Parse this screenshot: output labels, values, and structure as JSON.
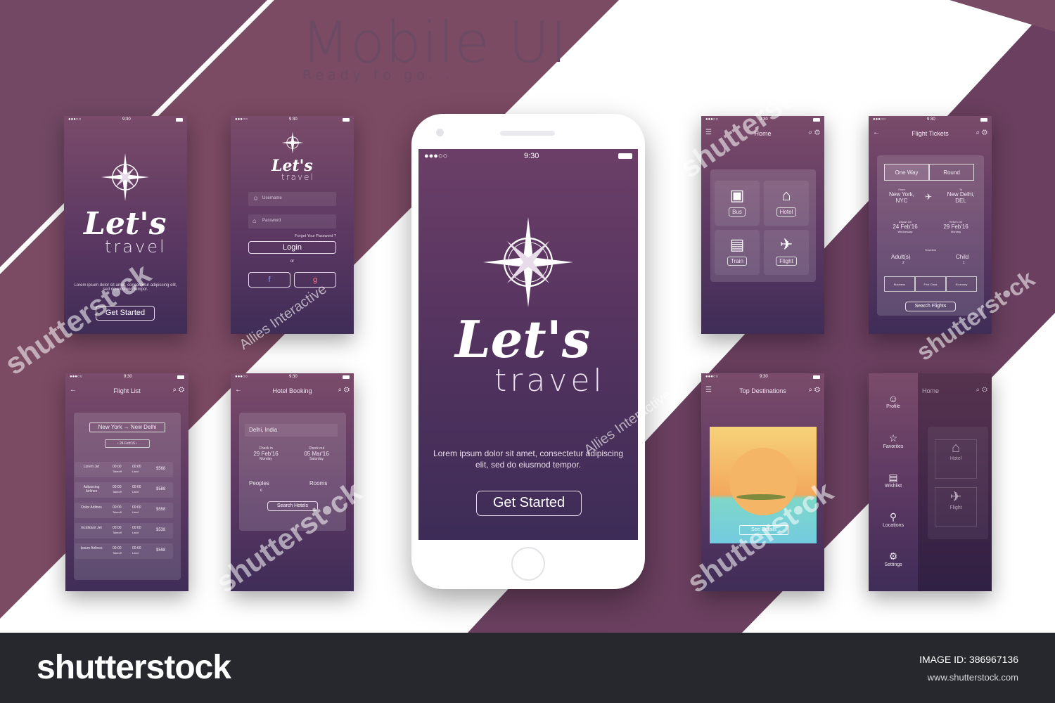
{
  "header": {
    "title": "Mobile UI",
    "subtitle": "Ready to go..."
  },
  "status": {
    "time": "9:30",
    "signal": "●●●○○"
  },
  "splash": {
    "lets": "Let's",
    "travel": "travel",
    "body": "Lorem ipsum dolor sit amet, consectetur adipiscing elit, sed do eiusmod tempor.",
    "cta": "Get Started"
  },
  "login": {
    "username_placeholder": "Username",
    "password_placeholder": "Password",
    "forgot": "Forget Your Password ?",
    "login": "Login",
    "or": "or",
    "facebook": "f",
    "google": "g"
  },
  "home": {
    "title": "Home",
    "tiles": [
      "Bus",
      "Hotel",
      "Train",
      "Flight"
    ]
  },
  "flight_tickets": {
    "title": "Flight Tickets",
    "one_way": "One Way",
    "round": "Round",
    "from_label": "From",
    "from": "New York, NYC",
    "to_label": "To",
    "to": "New Delhi, DEL",
    "depart_label": "Depart On",
    "depart": "24 Feb'16",
    "depart_day": "Wednesday",
    "return_label": "Return On",
    "return": "29 Feb'16",
    "return_day": "Monday",
    "travelers": "Travelers",
    "adults": "Adult(s)",
    "adults_count": "2",
    "child": "Child",
    "child_count": "1",
    "classes": [
      "Business",
      "First Class",
      "Economy"
    ],
    "search": "Search Flights"
  },
  "flight_list": {
    "title": "Flight List",
    "route_from": "New York",
    "route_to": "New Delhi",
    "date": "24 Feb'16",
    "rows": [
      {
        "name": "Lorem Jet",
        "takeoff": "00:00",
        "land": "00:00",
        "price": "$568"
      },
      {
        "name": "Adipiscing Airlines",
        "takeoff": "00:00",
        "land": "00:00",
        "price": "$588"
      },
      {
        "name": "Dolor Airlines",
        "takeoff": "00:00",
        "land": "00:00",
        "price": "$558"
      },
      {
        "name": "Incididunt Jet",
        "takeoff": "00:00",
        "land": "00:00",
        "price": "$538"
      },
      {
        "name": "Ipsum Airlines",
        "takeoff": "00:00",
        "land": "00:00",
        "price": "$598"
      }
    ],
    "takeoff_label": "Takeoff",
    "land_label": "Land"
  },
  "hotel_booking": {
    "title": "Hotel Booking",
    "location": "Delhi, India",
    "checkin_label": "Check in",
    "checkin": "29 Feb'16",
    "checkin_day": "Monday",
    "checkout_label": "Check out",
    "checkout": "05 Mar'16",
    "checkout_day": "Saturday",
    "peoples": "Peoples",
    "peoples_count": "6",
    "rooms": "Rooms",
    "search": "Search Hotels"
  },
  "top_destinations": {
    "title": "Top Destinations",
    "details": "See Details"
  },
  "side_menu": {
    "title": "Home",
    "items": [
      "Profile",
      "Favorites",
      "Wishlist",
      "Locations",
      "Settings"
    ],
    "tiles": [
      "Hotel",
      "Flight"
    ]
  },
  "footer": {
    "brand": "shutterstock",
    "image_id": "IMAGE ID: 386967136",
    "site": "www.shutterstock.com"
  },
  "watermarks": {
    "brand": "shutterst•ck",
    "studio": "Allies Interactive"
  },
  "colors": {
    "stripe": "#724864",
    "screen_top": "#7a4b6a",
    "screen_bottom": "#3f2d58",
    "footer": "#26282d"
  }
}
